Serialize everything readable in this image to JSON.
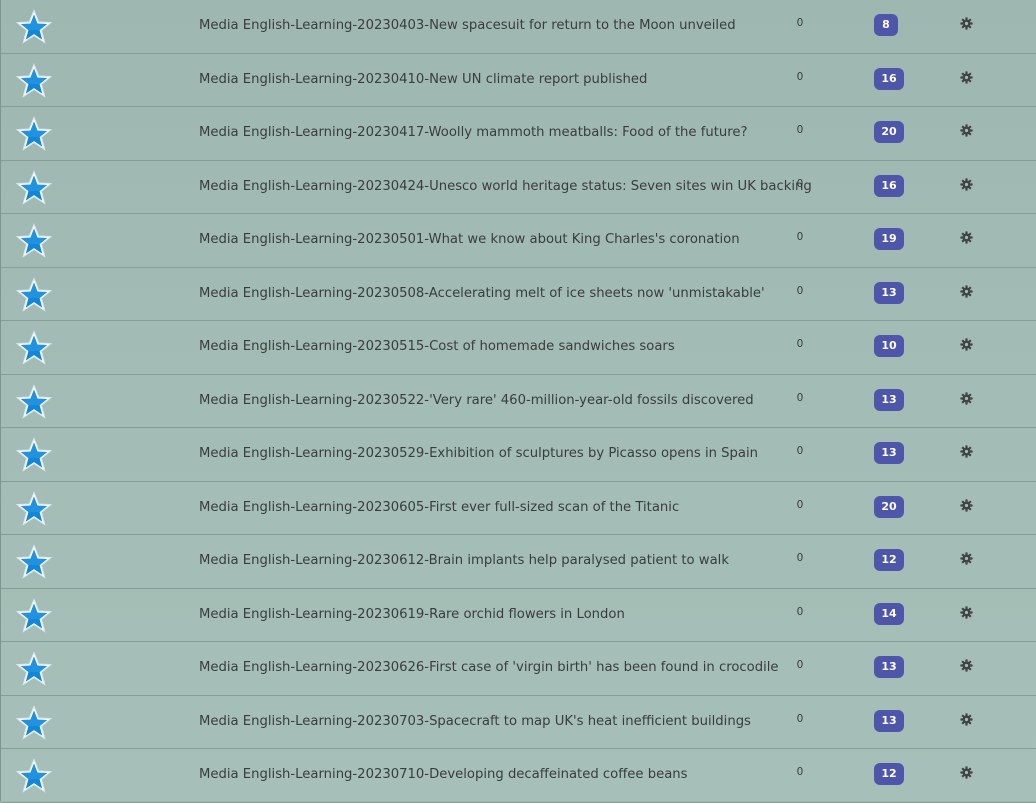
{
  "colors": {
    "star_fill": "#1287d8",
    "star_outline": "#ffffff",
    "badge_bg": "#4d56a8",
    "text": "#3a3d3c",
    "gear": "#3f4442"
  },
  "icons": {
    "favorite": "star-icon",
    "settings": "gear-icon"
  },
  "rows": [
    {
      "title": "Media English-Learning-20230403-New spacesuit for return to the Moon unveiled",
      "count": "0",
      "badge": "8"
    },
    {
      "title": "Media English-Learning-20230410-New UN climate report published",
      "count": "0",
      "badge": "16"
    },
    {
      "title": "Media English-Learning-20230417-Woolly mammoth meatballs: Food of the future?",
      "count": "0",
      "badge": "20"
    },
    {
      "title": "Media English-Learning-20230424-Unesco world heritage status: Seven sites win UK backing",
      "count": "0",
      "badge": "16"
    },
    {
      "title": "Media English-Learning-20230501-What we know about King Charles's coronation",
      "count": "0",
      "badge": "19"
    },
    {
      "title": "Media English-Learning-20230508-Accelerating melt of ice sheets now 'unmistakable'",
      "count": "0",
      "badge": "13"
    },
    {
      "title": "Media English-Learning-20230515-Cost of homemade sandwiches soars",
      "count": "0",
      "badge": "10"
    },
    {
      "title": "Media English-Learning-20230522-'Very rare' 460-million-year-old fossils discovered",
      "count": "0",
      "badge": "13"
    },
    {
      "title": "Media English-Learning-20230529-Exhibition of sculptures by Picasso opens in Spain",
      "count": "0",
      "badge": "13"
    },
    {
      "title": "Media English-Learning-20230605-First ever full-sized scan of the Titanic",
      "count": "0",
      "badge": "20"
    },
    {
      "title": "Media English-Learning-20230612-Brain implants help paralysed patient to walk",
      "count": "0",
      "badge": "12"
    },
    {
      "title": "Media English-Learning-20230619-Rare orchid flowers in London",
      "count": "0",
      "badge": "14"
    },
    {
      "title": "Media English-Learning-20230626-First case of 'virgin birth' has been found in crocodile",
      "count": "0",
      "badge": "13"
    },
    {
      "title": "Media English-Learning-20230703-Spacecraft to map UK's heat inefficient buildings",
      "count": "0",
      "badge": "13"
    },
    {
      "title": "Media English-Learning-20230710-Developing decaffeinated coffee beans",
      "count": "0",
      "badge": "12"
    }
  ]
}
